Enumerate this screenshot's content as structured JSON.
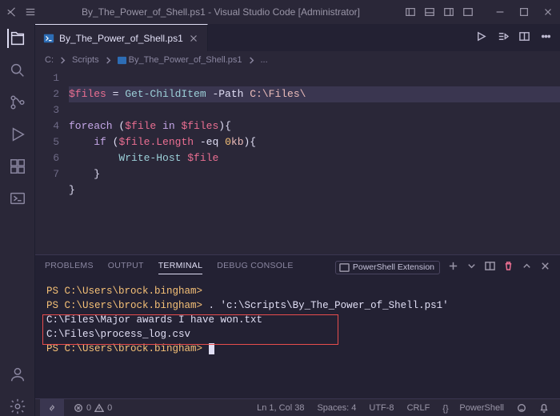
{
  "titlebar": {
    "title": "By_The_Power_of_Shell.ps1 - Visual Studio Code [Administrator]"
  },
  "tab": {
    "filename": "By_The_Power_of_Shell.ps1"
  },
  "breadcrumb": {
    "root": "C:",
    "folder": "Scripts",
    "file": "By_The_Power_of_Shell.ps1",
    "trail": "..."
  },
  "editor": {
    "lines": [
      "1",
      "2",
      "3",
      "4",
      "5",
      "6",
      "7"
    ],
    "l1": {
      "var": "$files",
      "op": " = ",
      "cmd": "Get-ChildItem",
      "p": " -Path ",
      "path": "C:\\Files\\"
    },
    "l3": {
      "kw1": "foreach",
      "open": " (",
      "var": "$file",
      "kw2": " in ",
      "var2": "$files",
      "close": "){"
    },
    "l4": {
      "pad": "    ",
      "kw": "if",
      "open": " (",
      "expr": "$file.Length",
      "op": " -eq ",
      "num": "0",
      "unit": "kb",
      "close": "){"
    },
    "l5": {
      "pad": "        ",
      "cmd": "Write-Host",
      "sp": " ",
      "var": "$file"
    },
    "l6": {
      "pad": "    ",
      "brace": "}"
    },
    "l7": {
      "brace": "}"
    }
  },
  "panel": {
    "tabs": {
      "problems": "PROBLEMS",
      "output": "OUTPUT",
      "terminal": "TERMINAL",
      "debug": "DEBUG CONSOLE"
    },
    "profile": "PowerShell Extension"
  },
  "terminal": {
    "line1": "PS C:\\Users\\brock.bingham>",
    "line2_pre": "PS C:\\Users\\brock.bingham> ",
    "line2_cmd": ". 'c:\\Scripts\\By_The_Power_of_Shell.ps1'",
    "line3": "C:\\Files\\Major awards I have won.txt",
    "line4": "C:\\Files\\process_log.csv",
    "line5": "PS C:\\Users\\brock.bingham> "
  },
  "statusbar": {
    "errors": "0",
    "warnings": "0",
    "position": "Ln 1, Col 38",
    "spaces": "Spaces: 4",
    "encoding": "UTF-8",
    "eol": "CRLF",
    "lang": "PowerShell"
  }
}
